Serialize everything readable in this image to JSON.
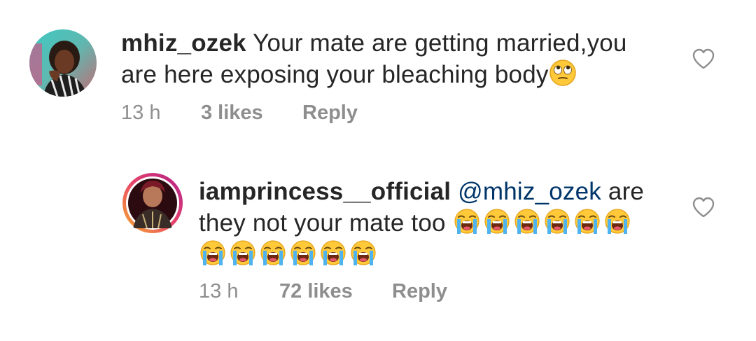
{
  "comments": [
    {
      "username": "mhiz_ozek",
      "text_parts": [
        "Your mate are getting married,you",
        "are here exposing your bleaching body"
      ],
      "trailing_emoji": "face-with-rolling-eyes",
      "time": "13 h",
      "likes": "3 likes",
      "reply": "Reply"
    },
    {
      "username": "iamprincess__official",
      "mention": "@mhiz_ozek",
      "text_parts": [
        "are",
        "they not your mate too"
      ],
      "emoji": "loudly-crying-face",
      "emoji_count_line1": 6,
      "emoji_count_line2": 6,
      "time": "13 h",
      "likes": "72 likes",
      "reply": "Reply"
    }
  ],
  "colors": {
    "text": "#262626",
    "meta": "#8e8e8e",
    "mention": "#003569",
    "heart": "#8e8e8e"
  }
}
